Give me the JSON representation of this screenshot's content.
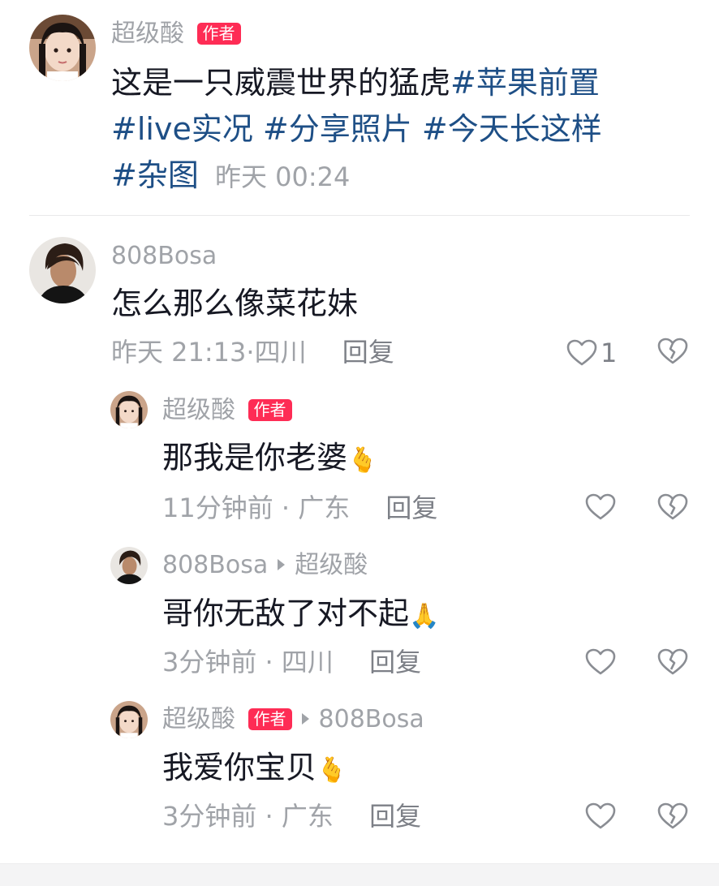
{
  "post": {
    "author": "超级酸",
    "author_badge": "作者",
    "text": "这是一只威震世界的猛虎",
    "tags": [
      "#苹果前置",
      "#live实况",
      "#分享照片",
      "#今天长这样",
      "#杂图"
    ],
    "time": "昨天 00:24"
  },
  "comment": {
    "user": "808Bosa",
    "text": "怎么那么像菜花妹",
    "meta": "昨天 21:13·四川",
    "reply_label": "回复",
    "like_count": "1"
  },
  "replies": [
    {
      "user": "超级酸",
      "badge": "作者",
      "text": "那我是你老婆",
      "emoji": "🫰",
      "meta": "11分钟前 · 广东",
      "reply_label": "回复"
    },
    {
      "user": "808Bosa",
      "reply_to": "超级酸",
      "text": "哥你无敌了对不起",
      "emoji": "🙏",
      "meta": "3分钟前 · 四川",
      "reply_label": "回复"
    },
    {
      "user": "超级酸",
      "badge": "作者",
      "reply_to": "808Bosa",
      "text": "我爱你宝贝",
      "emoji": "🫰",
      "meta": "3分钟前 · 广东",
      "reply_label": "回复"
    }
  ],
  "colors": {
    "accent": "#fe2c55",
    "hashtag": "#1e4f86",
    "muted": "#a0a3a8"
  },
  "icons": [
    "heart-icon",
    "dislike-broken-heart-icon",
    "reply-arrow-icon"
  ]
}
